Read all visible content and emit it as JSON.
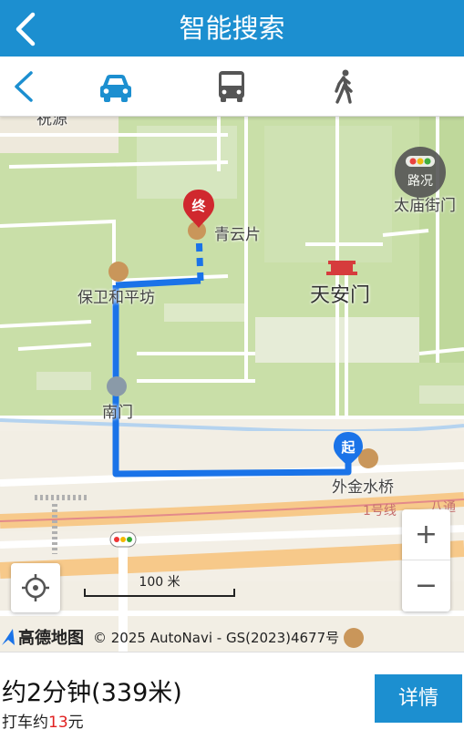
{
  "header": {
    "title": "智能搜索",
    "back_icon": "chevron-left-icon"
  },
  "modes": {
    "back_icon": "chevron-left-icon",
    "items": [
      {
        "name": "drive",
        "icon": "car-icon",
        "active": true
      },
      {
        "name": "bus",
        "icon": "bus-icon",
        "active": false
      },
      {
        "name": "walk",
        "icon": "walk-icon",
        "active": false
      }
    ]
  },
  "map": {
    "labels": {
      "top_partial": "祝源",
      "qingyunpian": "青云片",
      "baowei": "保卫和平坊",
      "tiananmen": "天安门",
      "taimiao": "太庙街门",
      "nanmen": "南门",
      "waijinshuiqiao": "外金水桥",
      "road_1": "1号线",
      "road_2": "八通"
    },
    "traffic_button": "路况",
    "end_marker": "终",
    "start_marker": "起",
    "scale_label": "100 米",
    "zoom_in": "+",
    "zoom_out": "−",
    "brand_name": "高德地图",
    "copyright": "© 2025 AutoNavi - GS(2023)4677号",
    "colors": {
      "route": "#1a73e8",
      "end_marker": "#d0282e",
      "start_marker": "#1a73e8"
    }
  },
  "route_info": {
    "duration": "约2分钟(339米)",
    "taxi_prefix": "打车约",
    "taxi_fare": "13",
    "taxi_suffix": "元",
    "detail_button": "详情"
  }
}
